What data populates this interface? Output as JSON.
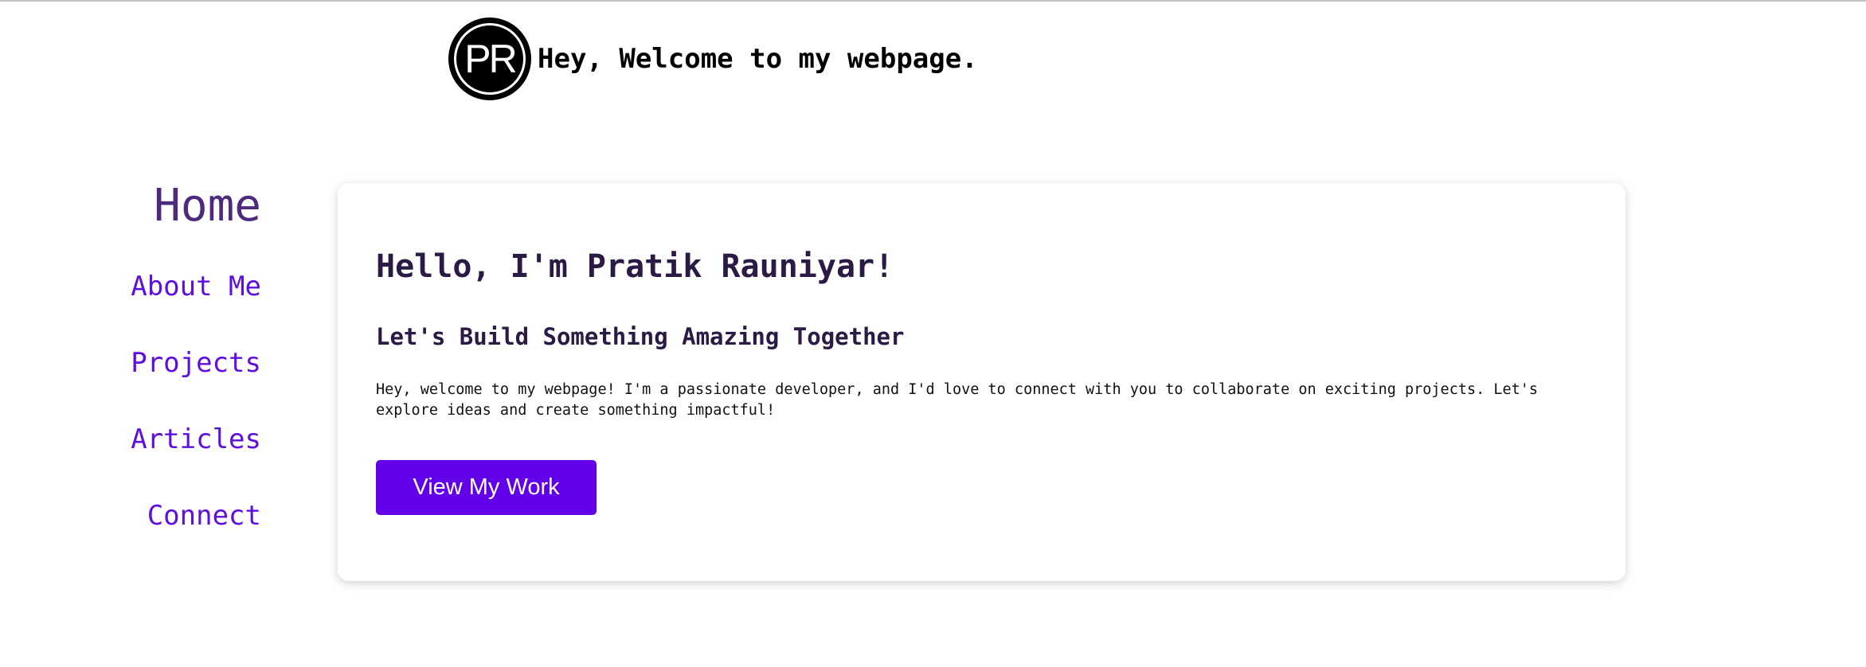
{
  "header": {
    "logo_text": "PR",
    "title": "Hey, Welcome to my webpage."
  },
  "nav": {
    "items": [
      {
        "label": "Home",
        "active": true
      },
      {
        "label": "About Me",
        "active": false
      },
      {
        "label": "Projects",
        "active": false
      },
      {
        "label": "Articles",
        "active": false
      },
      {
        "label": "Connect",
        "active": false
      }
    ]
  },
  "hero": {
    "title": "Hello, I'm Pratik Rauniyar!",
    "subtitle": "Let's Build Something Amazing Together",
    "description": "Hey, welcome to my webpage! I'm a passionate developer, and I'd love to connect with you to collaborate on exciting projects. Let's explore ideas and create something impactful!",
    "cta_label": "View My Work"
  },
  "colors": {
    "accent": "#6200ea",
    "nav_active": "#4e2a7e",
    "nav_link": "#5f0ee0",
    "heading": "#2a1a44"
  }
}
